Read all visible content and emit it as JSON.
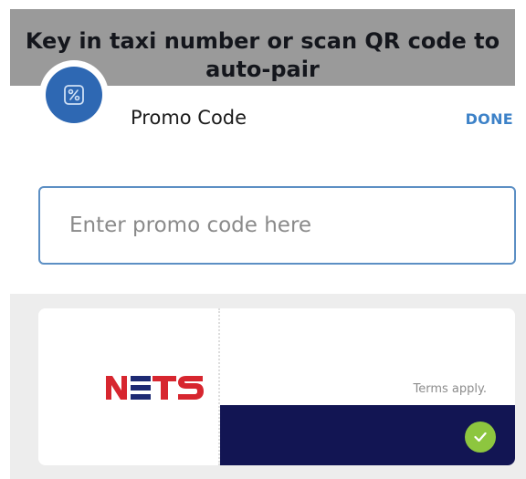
{
  "banner": {
    "text": "Key in taxi number or scan QR code to auto-pair"
  },
  "header": {
    "icon": "promo-ticket-icon",
    "title": "Promo Code",
    "done_label": "DONE"
  },
  "promo_input": {
    "value": "",
    "placeholder": "Enter promo code here"
  },
  "voucher": {
    "brand": "NETS",
    "terms": "Terms apply.",
    "status_icon": "check-icon",
    "colors": {
      "brand_red": "#d7262f",
      "brand_navy": "#1d2a73",
      "footer": "#121553",
      "check": "#8dc63f"
    }
  },
  "colors": {
    "accent": "#3d82c8",
    "avatar": "#2e68b3",
    "banner": "#9a9a9a"
  }
}
